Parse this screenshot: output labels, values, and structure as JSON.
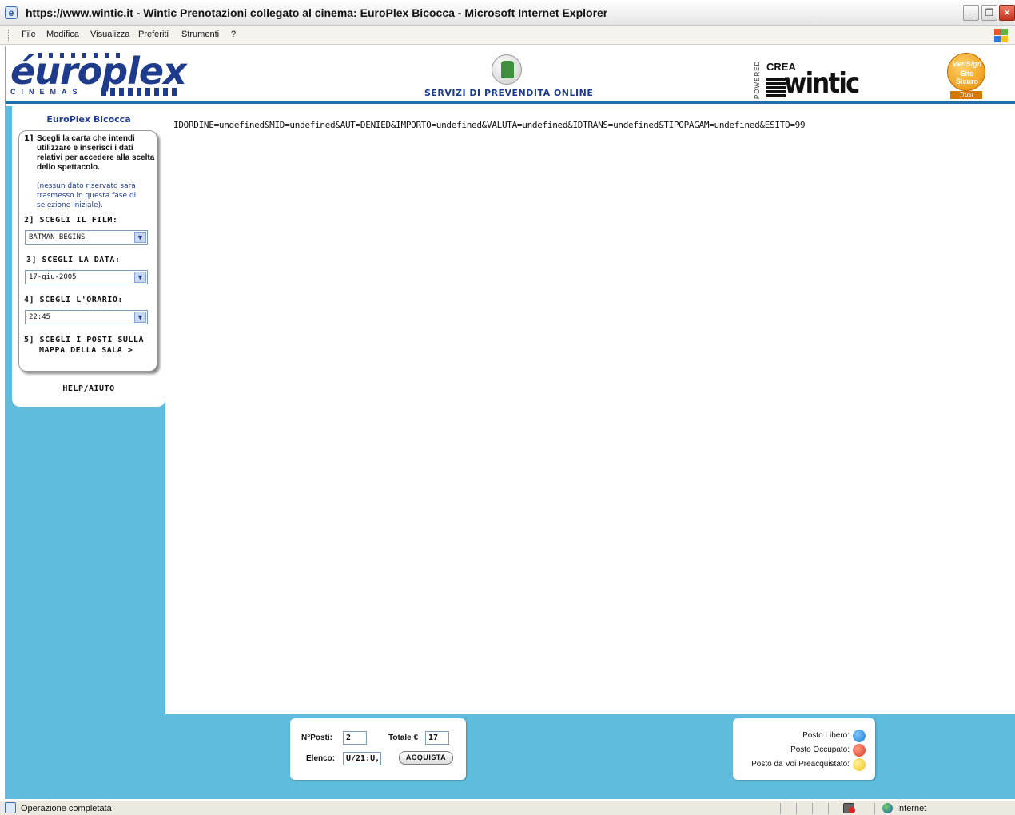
{
  "window": {
    "title": "https://www.wintic.it - Wintic Prenotazioni collegato al cinema: EuroPlex Bicocca - Microsoft Internet Explorer",
    "controls": {
      "minimize": "_",
      "restore": "❐",
      "close": "✕"
    }
  },
  "menu": {
    "items": [
      "File",
      "Modifica",
      "Visualizza",
      "Preferiti",
      "Strumenti",
      "?"
    ]
  },
  "header": {
    "logo_text": "éuroplex",
    "logo_sub": "CINEMAS",
    "caption": "SERVIZI DI PREVENDITA ONLINE",
    "powered": "POWERED",
    "crea": "CREA",
    "wintic": "wintic",
    "verisign": {
      "line1": "VeriSign",
      "line2": "Sito",
      "line3": "Sicuro",
      "trust": "Trust"
    }
  },
  "sidebar": {
    "cinema": "EuroPlex Bicocca",
    "step1": {
      "num": "1]",
      "text": "Scegli la carta che intendi utilizzare e inserisci i dati relativi per accedere alla scelta dello spettacolo.",
      "note": "(nessun dato riservato sarà trasmesso in questa fase di selezione iniziale)."
    },
    "step2": {
      "label": "2] SCEGLI IL FILM:",
      "value": "BATMAN BEGINS"
    },
    "step3": {
      "label": "3] SCEGLI LA DATA:",
      "value": "17-giu-2005"
    },
    "step4": {
      "label": "4] SCEGLI L'ORARIO:",
      "value": "22:45"
    },
    "step5": {
      "line1": "5] SCEGLI I POSTI SULLA",
      "line2": "MAPPA DELLA SALA >"
    },
    "help": "HELP/AIUTO"
  },
  "content": {
    "query": "IDORDINE=undefined&MID=undefined&AUT=DENIED&IMPORTO=undefined&VALUTA=undefined&IDTRANS=undefined&TIPOPAGAM=undefined&ESITO=99"
  },
  "footer": {
    "posti_label": "N°Posti:",
    "posti_value": "2",
    "totale_label": "Totale €",
    "totale_value": "17",
    "elenco_label": "Elenco:",
    "elenco_value": "U/21:U,",
    "buy_label": "ACQUISTA",
    "legend": [
      {
        "label": "Posto Libero:",
        "color": "#1a7fd4"
      },
      {
        "label": "Posto Occupato:",
        "color": "#d83a2a"
      },
      {
        "label": "Posto da Voi Preacquistato:",
        "color": "#f2c21a"
      }
    ]
  },
  "statusbar": {
    "message": "Operazione completata",
    "zone": "Internet"
  }
}
